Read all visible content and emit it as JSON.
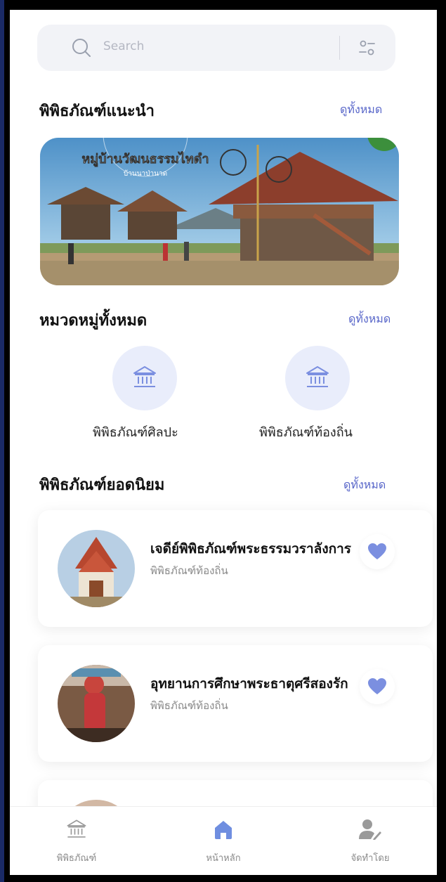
{
  "search": {
    "placeholder": "Search"
  },
  "featured": {
    "title": "พิพิธภัณฑ์แนะนำ",
    "see_all": "ดูทั้งหมด",
    "banner_title": "หมู่บ้านวัฒนธรรมไทดำ",
    "banner_subtitle": "บ้านนาป่านาด"
  },
  "categories": {
    "title": "หมวดหมู่ทั้งหมด",
    "see_all": "ดูทั้งหมด",
    "items": [
      {
        "label": "พิพิธภัณฑ์ศิลปะ",
        "icon": "museum-icon"
      },
      {
        "label": "พิพิธภัณฑ์ท้องถิ่น",
        "icon": "museum-icon"
      }
    ]
  },
  "popular": {
    "title": "พิพิธภัณฑ์ยอดนิยม",
    "see_all": "ดูทั้งหมด",
    "items": [
      {
        "name": "เจดีย์พิพิธภัณฑ์พระธรรมวราลังการ",
        "category": "พิพิธภัณฑ์ท้องถิ่น"
      },
      {
        "name": "อุทยานการศึกษาพระธาตุศรีสองรัก",
        "category": "พิพิธภัณฑ์ท้องถิ่น"
      }
    ]
  },
  "bottom_nav": {
    "items": [
      {
        "label": "พิพิธภัณฑ์",
        "icon": "museum-icon",
        "active": false
      },
      {
        "label": "หน้าหลัก",
        "icon": "home-icon",
        "active": true
      },
      {
        "label": "จัดทำโดย",
        "icon": "user-edit-icon",
        "active": false
      }
    ]
  },
  "colors": {
    "accent": "#5866c9",
    "category_bg": "#e9edfb",
    "heart": "#7b8fe0",
    "home_active": "#6f8ee0"
  }
}
